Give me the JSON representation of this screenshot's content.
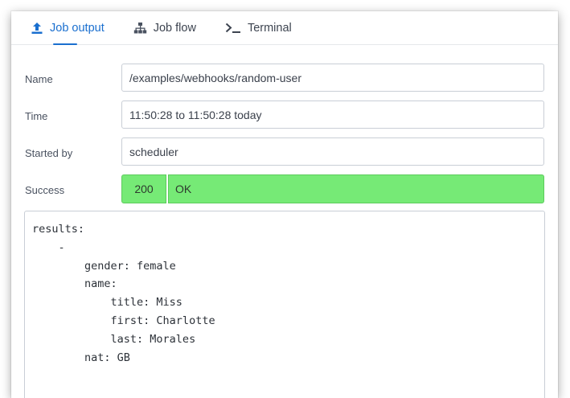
{
  "tabs": [
    {
      "label": "Job output",
      "icon": "upload-icon",
      "active": true
    },
    {
      "label": "Job flow",
      "icon": "hierarchy-icon",
      "active": false
    },
    {
      "label": "Terminal",
      "icon": "terminal-prompt-icon",
      "active": false
    }
  ],
  "fields": {
    "name": {
      "label": "Name",
      "value": "/examples/webhooks/random-user"
    },
    "time": {
      "label": "Time",
      "value": "11:50:28 to 11:50:28 today"
    },
    "started_by": {
      "label": "Started by",
      "value": "scheduler"
    },
    "success": {
      "label": "Success",
      "code": "200",
      "text": "OK"
    }
  },
  "output": {
    "lines": [
      "results:",
      "    -",
      "        gender: female",
      "        name:",
      "            title: Miss",
      "            first: Charlotte",
      "            last: Morales",
      "        nat: GB"
    ]
  },
  "colors": {
    "accent": "#1a6fcf",
    "success": "#76ea76"
  }
}
